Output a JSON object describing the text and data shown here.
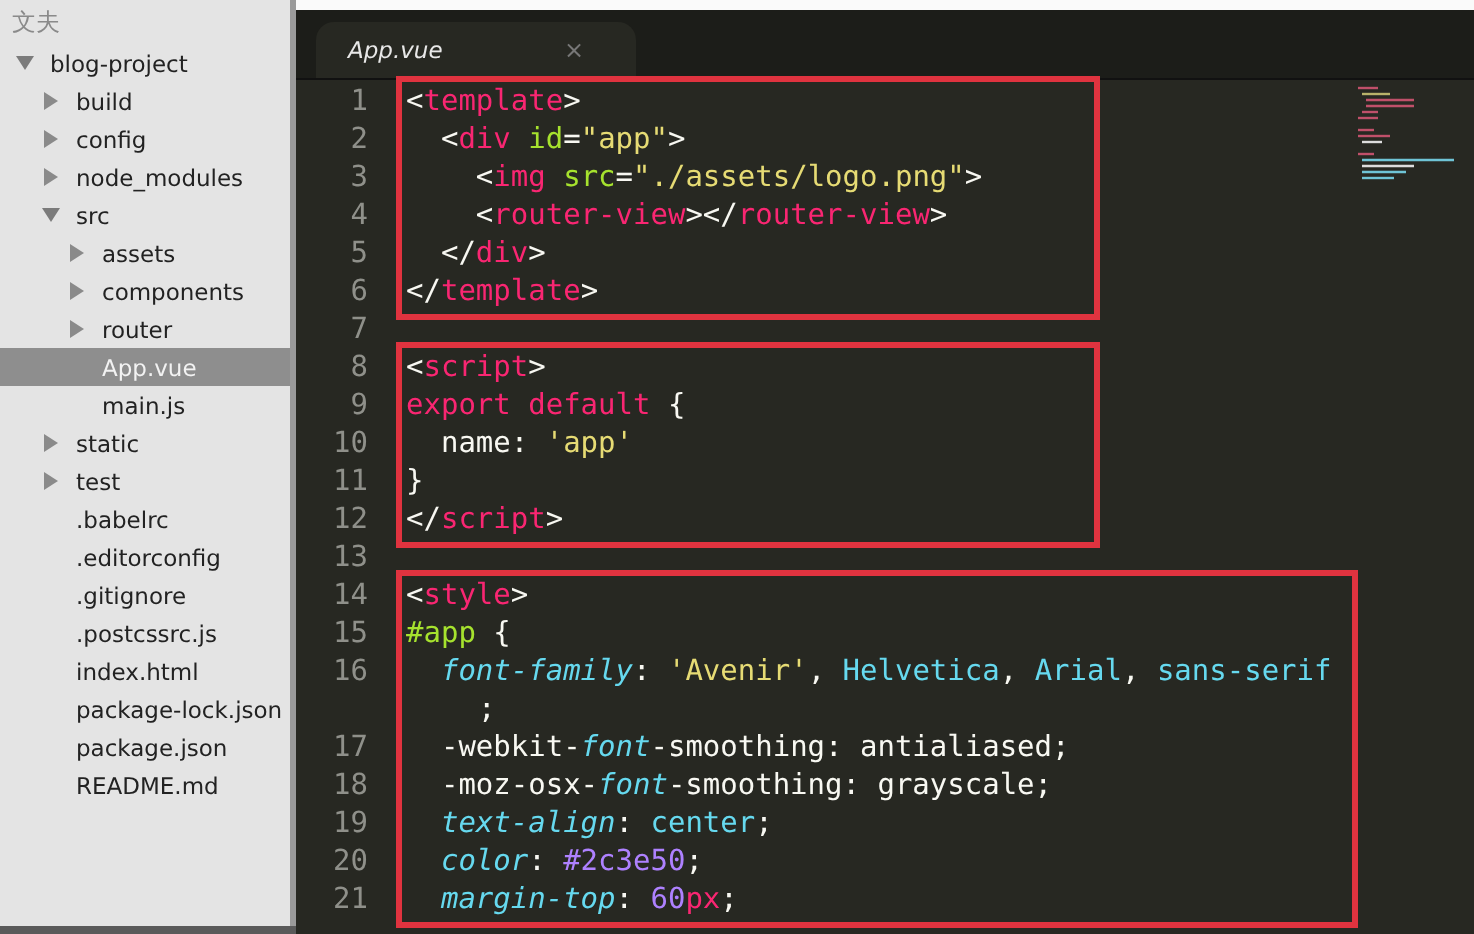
{
  "sidebar": {
    "header": "文夫",
    "tree": [
      {
        "name": "blog-project",
        "kind": "folder",
        "expanded": true,
        "selected": false,
        "children": [
          {
            "name": "build",
            "kind": "folder",
            "expanded": false,
            "selected": false
          },
          {
            "name": "config",
            "kind": "folder",
            "expanded": false,
            "selected": false
          },
          {
            "name": "node_modules",
            "kind": "folder",
            "expanded": false,
            "selected": false
          },
          {
            "name": "src",
            "kind": "folder",
            "expanded": true,
            "selected": false,
            "children": [
              {
                "name": "assets",
                "kind": "folder",
                "expanded": false,
                "selected": false
              },
              {
                "name": "components",
                "kind": "folder",
                "expanded": false,
                "selected": false
              },
              {
                "name": "router",
                "kind": "folder",
                "expanded": false,
                "selected": false
              },
              {
                "name": "App.vue",
                "kind": "file",
                "selected": true
              },
              {
                "name": "main.js",
                "kind": "file",
                "selected": false
              }
            ]
          },
          {
            "name": "static",
            "kind": "folder",
            "expanded": false,
            "selected": false
          },
          {
            "name": "test",
            "kind": "folder",
            "expanded": false,
            "selected": false
          },
          {
            "name": ".babelrc",
            "kind": "file",
            "selected": false
          },
          {
            "name": ".editorconfig",
            "kind": "file",
            "selected": false
          },
          {
            "name": ".gitignore",
            "kind": "file",
            "selected": false
          },
          {
            "name": ".postcssrc.js",
            "kind": "file",
            "selected": false
          },
          {
            "name": "index.html",
            "kind": "file",
            "selected": false
          },
          {
            "name": "package-lock.json",
            "kind": "file",
            "selected": false
          },
          {
            "name": "package.json",
            "kind": "file",
            "selected": false
          },
          {
            "name": "README.md",
            "kind": "file",
            "selected": false
          }
        ]
      }
    ]
  },
  "tabs": [
    {
      "label": "App.vue",
      "close": "×",
      "selected": true
    }
  ],
  "editor": {
    "blocks": [
      {
        "framed": true,
        "lines": [
          {
            "number": "1",
            "tokens": [
              {
                "t": "<",
                "kind": "punct"
              },
              {
                "t": "template",
                "kind": "tag"
              },
              {
                "t": ">",
                "kind": "punct"
              }
            ]
          },
          {
            "number": "2",
            "tokens": [
              {
                "t": "  <",
                "kind": "punct"
              },
              {
                "t": "div",
                "kind": "tag"
              },
              {
                "t": " id",
                "kind": "attr"
              },
              {
                "t": "=",
                "kind": "punct"
              },
              {
                "t": "\"app\"",
                "kind": "string"
              },
              {
                "t": ">",
                "kind": "punct"
              }
            ]
          },
          {
            "number": "3",
            "tokens": [
              {
                "t": "    <",
                "kind": "punct"
              },
              {
                "t": "img",
                "kind": "tag"
              },
              {
                "t": " src",
                "kind": "attr"
              },
              {
                "t": "=",
                "kind": "punct"
              },
              {
                "t": "\"./assets/logo.png\"",
                "kind": "string"
              },
              {
                "t": ">",
                "kind": "punct"
              }
            ]
          },
          {
            "number": "4",
            "tokens": [
              {
                "t": "    <",
                "kind": "punct"
              },
              {
                "t": "router-view",
                "kind": "tag"
              },
              {
                "t": "></",
                "kind": "punct"
              },
              {
                "t": "router-view",
                "kind": "tag"
              },
              {
                "t": ">",
                "kind": "punct"
              }
            ]
          },
          {
            "number": "5",
            "tokens": [
              {
                "t": "  </",
                "kind": "punct"
              },
              {
                "t": "div",
                "kind": "tag"
              },
              {
                "t": ">",
                "kind": "punct"
              }
            ]
          },
          {
            "number": "6",
            "tokens": [
              {
                "t": "</",
                "kind": "punct"
              },
              {
                "t": "template",
                "kind": "tag"
              },
              {
                "t": ">",
                "kind": "punct"
              }
            ]
          }
        ]
      },
      {
        "framed": false,
        "lines": [
          {
            "number": "7"
          }
        ]
      },
      {
        "framed": true,
        "lines": [
          {
            "number": "8",
            "tokens": [
              {
                "t": "<",
                "kind": "punct"
              },
              {
                "t": "script",
                "kind": "tag"
              },
              {
                "t": ">",
                "kind": "punct"
              }
            ]
          },
          {
            "number": "9",
            "tokens": [
              {
                "t": "export",
                "kind": "keyword"
              },
              {
                "t": " default",
                "kind": "keyword"
              },
              {
                "t": " {",
                "kind": "plain"
              }
            ]
          },
          {
            "number": "10",
            "tokens": [
              {
                "t": "  name: ",
                "kind": "plain"
              },
              {
                "t": "'app'",
                "kind": "string"
              }
            ]
          },
          {
            "number": "11",
            "tokens": [
              {
                "t": "}",
                "kind": "plain"
              }
            ]
          },
          {
            "number": "12",
            "tokens": [
              {
                "t": "</",
                "kind": "punct"
              },
              {
                "t": "script",
                "kind": "tag"
              },
              {
                "t": ">",
                "kind": "punct"
              }
            ]
          }
        ]
      },
      {
        "framed": false,
        "lines": [
          {
            "number": "13"
          }
        ]
      },
      {
        "framed": true,
        "lines": [
          {
            "number": "14",
            "tokens": [
              {
                "t": "<",
                "kind": "punct"
              },
              {
                "t": "style",
                "kind": "tag"
              },
              {
                "t": ">",
                "kind": "punct"
              }
            ]
          },
          {
            "number": "15",
            "tokens": [
              {
                "t": "#app",
                "kind": "attr"
              },
              {
                "t": " {",
                "kind": "plain"
              }
            ]
          },
          {
            "number": "16",
            "tokens": [
              {
                "t": "  font-family",
                "kind": "prop"
              },
              {
                "t": ": ",
                "kind": "plain"
              },
              {
                "t": "'Avenir'",
                "kind": "string"
              },
              {
                "t": ", ",
                "kind": "plain"
              },
              {
                "t": "Helvetica",
                "kind": "value"
              },
              {
                "t": ", ",
                "kind": "plain"
              },
              {
                "t": "Arial",
                "kind": "value"
              },
              {
                "t": ", ",
                "kind": "plain"
              },
              {
                "t": "sans-serif",
                "kind": "value"
              }
            ],
            "wrap": [
              {
                "t": ";",
                "kind": "plain"
              }
            ]
          },
          {
            "number": "17",
            "tokens": [
              {
                "t": "  -webkit-",
                "kind": "plain"
              },
              {
                "t": "font",
                "kind": "prop"
              },
              {
                "t": "-smoothing: antialiased;",
                "kind": "plain"
              }
            ]
          },
          {
            "number": "18",
            "tokens": [
              {
                "t": "  -moz-osx-",
                "kind": "plain"
              },
              {
                "t": "font",
                "kind": "prop"
              },
              {
                "t": "-smoothing: grayscale;",
                "kind": "plain"
              }
            ]
          },
          {
            "number": "19",
            "tokens": [
              {
                "t": "  text-align",
                "kind": "prop"
              },
              {
                "t": ": ",
                "kind": "plain"
              },
              {
                "t": "center",
                "kind": "value"
              },
              {
                "t": ";",
                "kind": "plain"
              }
            ]
          },
          {
            "number": "20",
            "tokens": [
              {
                "t": "  color",
                "kind": "prop"
              },
              {
                "t": ": ",
                "kind": "plain"
              },
              {
                "t": "#2c3e50",
                "kind": "number"
              },
              {
                "t": ";",
                "kind": "plain"
              }
            ]
          },
          {
            "number": "21",
            "tokens": [
              {
                "t": "  margin-top",
                "kind": "prop"
              },
              {
                "t": ": ",
                "kind": "plain"
              },
              {
                "t": "60",
                "kind": "number"
              },
              {
                "t": "px",
                "kind": "unit"
              },
              {
                "t": ";",
                "kind": "plain"
              }
            ]
          }
        ]
      }
    ]
  }
}
